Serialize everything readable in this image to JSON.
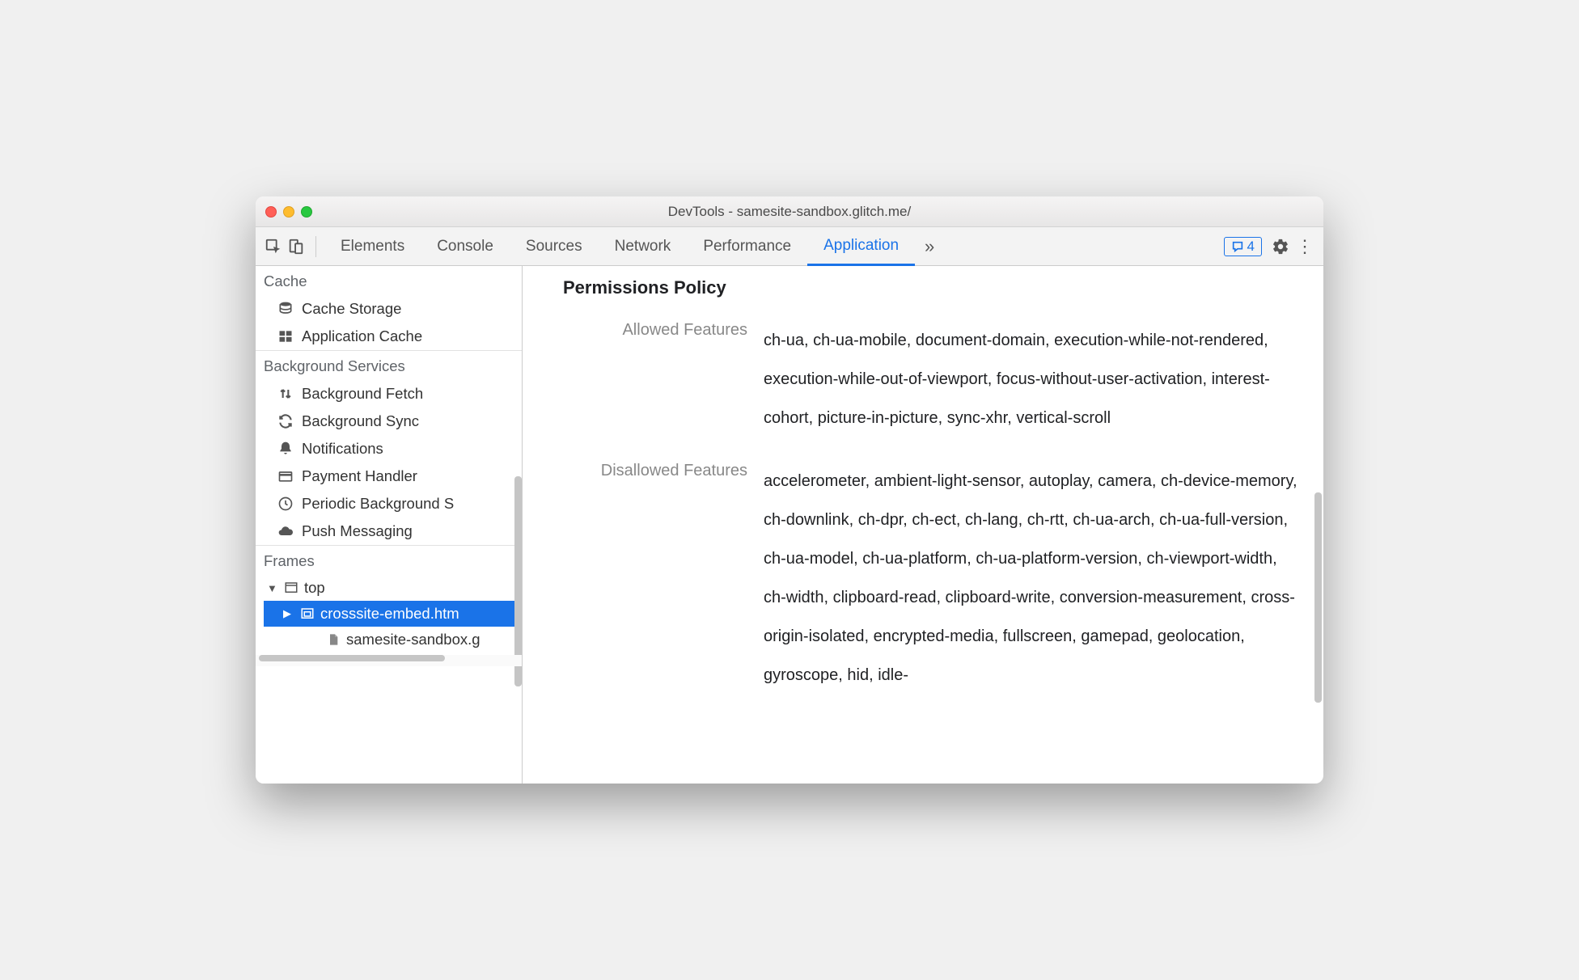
{
  "window": {
    "title": "DevTools - samesite-sandbox.glitch.me/"
  },
  "toolbar": {
    "tabs": [
      "Elements",
      "Console",
      "Sources",
      "Network",
      "Performance",
      "Application"
    ],
    "active_tab": "Application",
    "more_tabs_icon": "»",
    "messages_count": "4"
  },
  "sidebar": {
    "sections": [
      {
        "title": "Cache",
        "items": [
          {
            "icon": "database-icon",
            "label": "Cache Storage"
          },
          {
            "icon": "grid-icon",
            "label": "Application Cache"
          }
        ]
      },
      {
        "title": "Background Services",
        "items": [
          {
            "icon": "updown-icon",
            "label": "Background Fetch"
          },
          {
            "icon": "sync-icon",
            "label": "Background Sync"
          },
          {
            "icon": "bell-icon",
            "label": "Notifications"
          },
          {
            "icon": "card-icon",
            "label": "Payment Handler"
          },
          {
            "icon": "clock-icon",
            "label": "Periodic Background S"
          },
          {
            "icon": "cloud-icon",
            "label": "Push Messaging"
          }
        ]
      },
      {
        "title": "Frames",
        "tree": [
          {
            "level": 0,
            "arrow": "▼",
            "icon": "window-icon",
            "label": "top",
            "selected": false
          },
          {
            "level": 1,
            "arrow": "▶",
            "icon": "embed-icon",
            "label": "crosssite-embed.htm",
            "selected": true
          },
          {
            "level": 1,
            "arrow": "",
            "icon": "file-icon",
            "label": "samesite-sandbox.g",
            "selected": false
          }
        ]
      }
    ]
  },
  "main": {
    "heading": "Permissions Policy",
    "rows": [
      {
        "label": "Allowed Features",
        "value": "ch-ua, ch-ua-mobile, document-domain, execution-while-not-rendered, execution-while-out-of-viewport, focus-without-user-activation, interest-cohort, picture-in-picture, sync-xhr, vertical-scroll"
      },
      {
        "label": "Disallowed Features",
        "value": "accelerometer, ambient-light-sensor, autoplay, camera, ch-device-memory, ch-downlink, ch-dpr, ch-ect, ch-lang, ch-rtt, ch-ua-arch, ch-ua-full-version, ch-ua-model, ch-ua-platform, ch-ua-platform-version, ch-viewport-width, ch-width, clipboard-read, clipboard-write, conversion-measurement, cross-origin-isolated, encrypted-media, fullscreen, gamepad, geolocation, gyroscope, hid, idle-"
      }
    ]
  }
}
